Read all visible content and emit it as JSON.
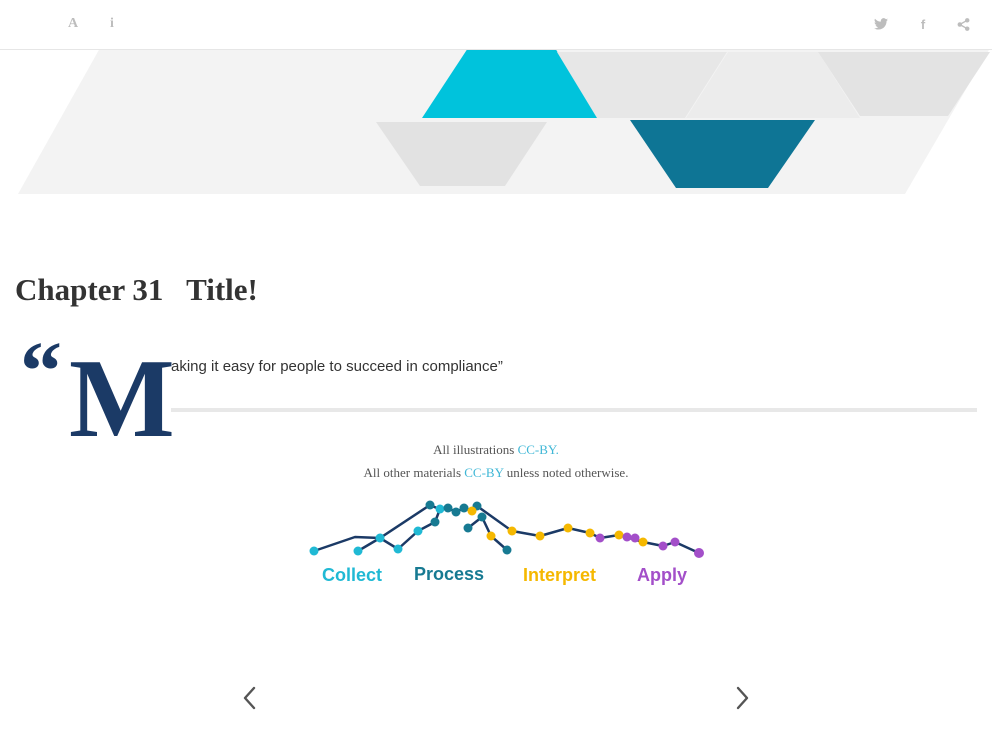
{
  "toolbar": {
    "font_icon": "A",
    "info_icon": "i",
    "facebook_icon": "f",
    "icons": [
      "font-settings-icon",
      "info-icon",
      "twitter-icon",
      "facebook-icon",
      "share-icon"
    ]
  },
  "colors": {
    "cyan": "#00c3dc",
    "teal_dark": "#0e7595",
    "navy": "#1b3a66",
    "yellow": "#f5b800",
    "purple": "#a34fc9",
    "light_gray": "#f2f2f2",
    "link": "#3fb7d6"
  },
  "chapter": {
    "title": "Chapter 31   Title!"
  },
  "quote": {
    "open_mark": "“",
    "drop_cap": "M",
    "text": "aking it easy for people to succeed in compliance”"
  },
  "license": {
    "line1_prefix": "All illustrations ",
    "line1_link": "CC-BY.",
    "line2_prefix": "All other materials ",
    "line2_link": "CC-BY",
    "line2_suffix": " unless noted otherwise."
  },
  "stages": {
    "labels": [
      "Collect",
      "Process",
      "Interpret",
      "Apply"
    ]
  },
  "navigation": {
    "prev_icon": "chevron-left-icon",
    "next_icon": "chevron-right-icon"
  }
}
